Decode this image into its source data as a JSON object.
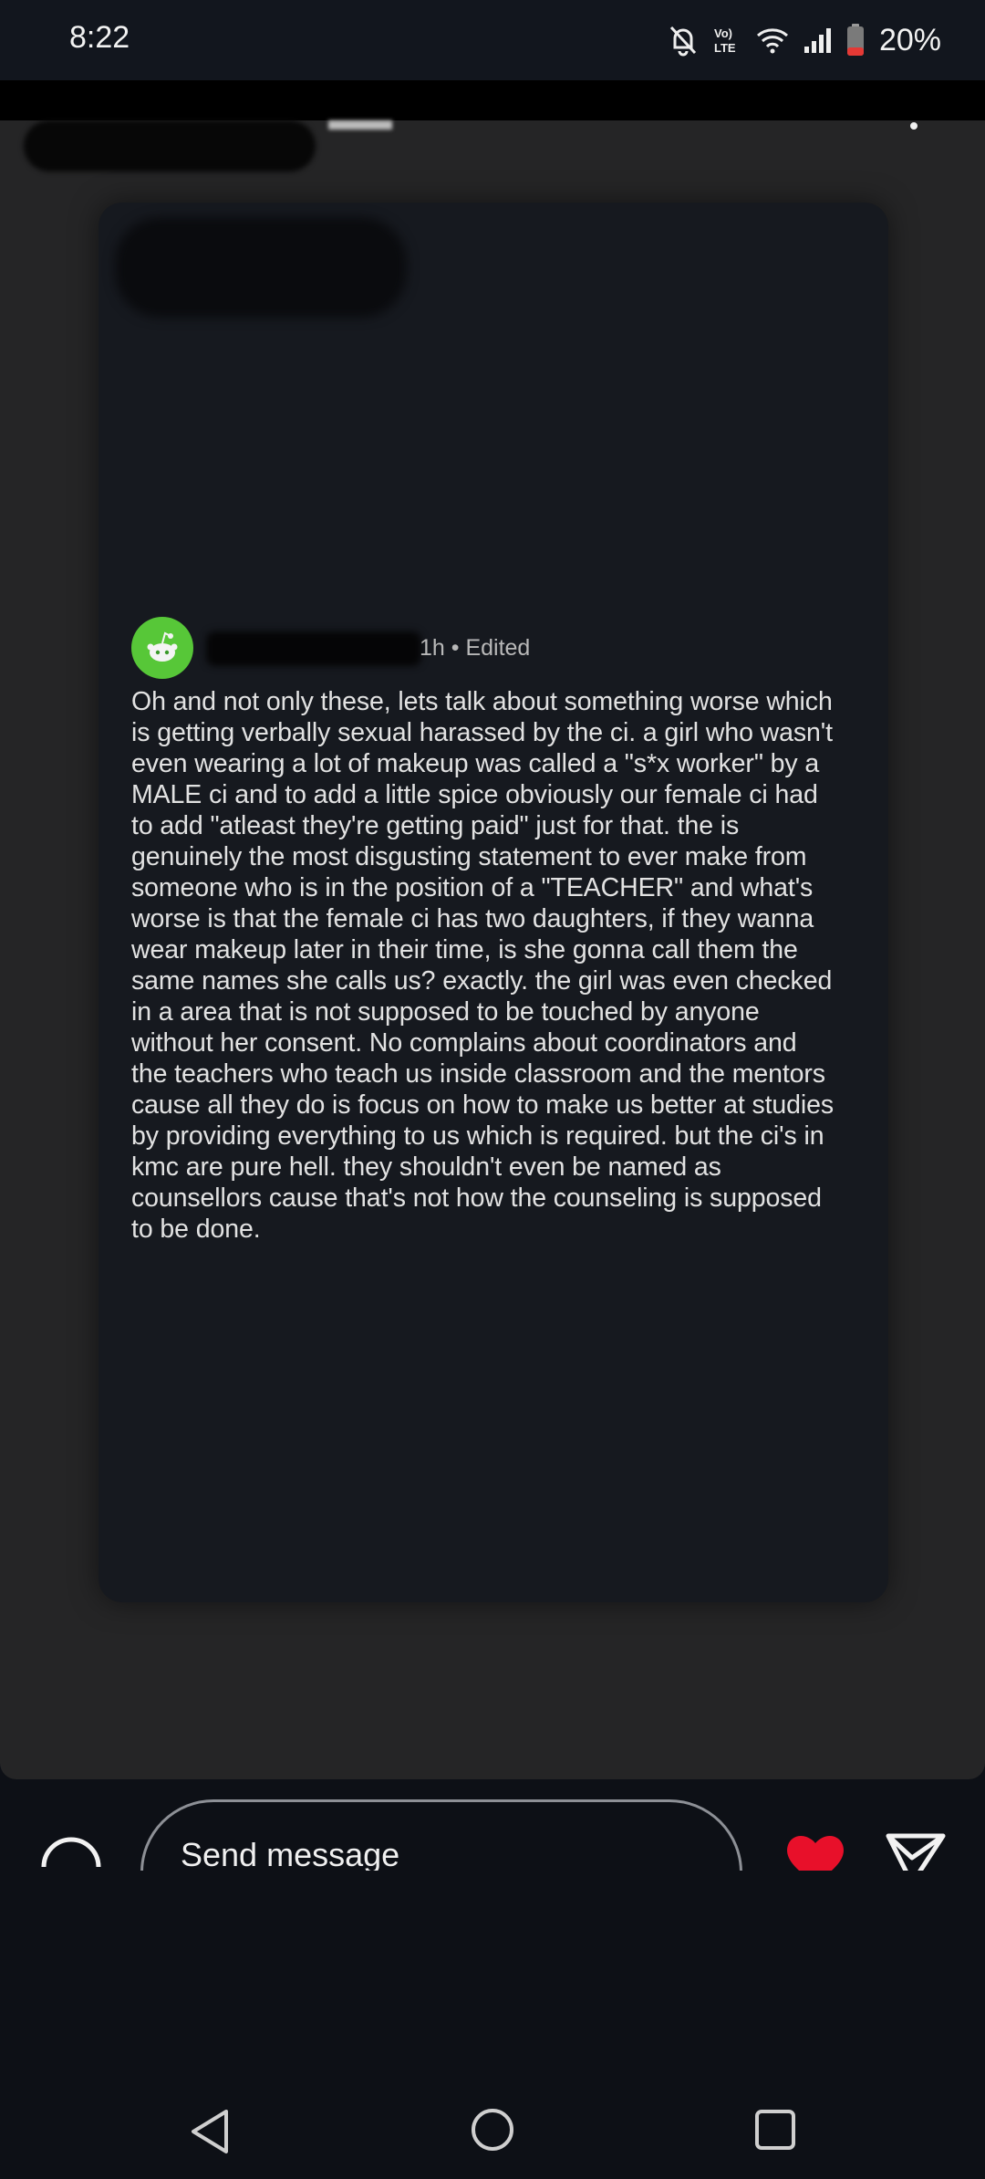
{
  "status_bar": {
    "time": "8:22",
    "network_label": "Vo) LTE",
    "battery": "20%",
    "icons": [
      "mute-bell-icon",
      "volte-icon",
      "wifi-icon",
      "signal-icon",
      "battery-icon"
    ]
  },
  "post": {
    "meta": "1h • Edited",
    "avatar_color": "#57c738",
    "body": "Oh and not only these, lets talk about something worse which\nis getting verbally sexual harassed by the ci. a girl who wasn't\neven wearing a lot of makeup was called a \"s*x worker\" by a\nMALE ci and to add a little spice obviously our female ci had\nto add \"atleast they're getting paid\" just for that. the is\ngenuinely the most disgusting statement to ever make from\nsomeone who is in the position of a \"TEACHER\" and what's\nworse is that the female ci has two daughters, if they wanna\nwear makeup later in their time, is she gonna call them the\nsame names she calls us? exactly. the girl was even checked\nin a area that is not supposed to be touched by anyone\nwithout her consent. No complains about coordinators and\nthe teachers who teach us inside classroom and the mentors\ncause all they do is focus on how to make us better at studies\nby providing everything to us which is required. but the ci's in\nkmc are pure hell. they shouldn't even be named as\ncounsellors cause that's not how the counseling is supposed\nto be done."
  },
  "composer": {
    "placeholder": "Send message",
    "heart_color": "#e8102a"
  },
  "nav": {
    "icons": [
      "back-icon",
      "home-icon",
      "recents-icon"
    ]
  }
}
